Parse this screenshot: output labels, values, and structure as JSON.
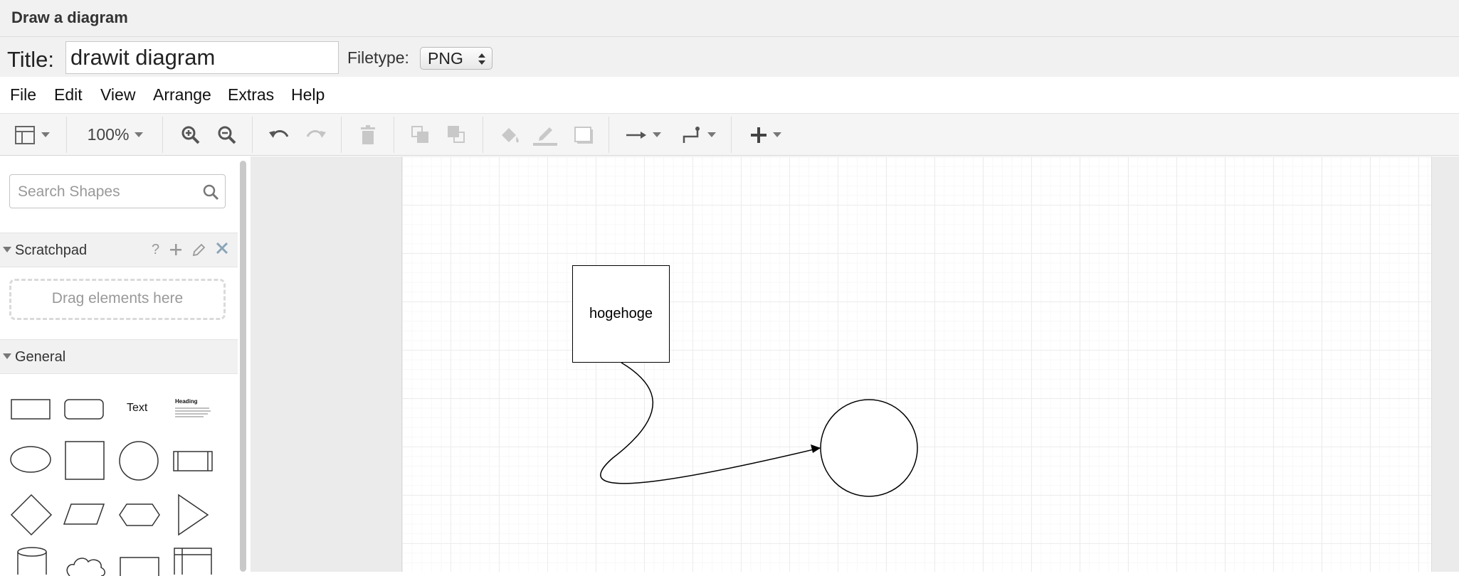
{
  "window": {
    "title": "Draw a diagram"
  },
  "form": {
    "title_label": "Title:",
    "title_value": "drawit diagram",
    "filetype_label": "Filetype:",
    "filetype_value": "PNG"
  },
  "menu": [
    "File",
    "Edit",
    "View",
    "Arrange",
    "Extras",
    "Help"
  ],
  "toolbar": {
    "zoom": "100%"
  },
  "sidebar": {
    "search_placeholder": "Search Shapes",
    "scratchpad": {
      "label": "Scratchpad",
      "help": "?",
      "dropzone": "Drag elements here"
    },
    "general": {
      "label": "General",
      "text_shape": "Text",
      "heading_shape": "Heading"
    }
  },
  "diagram": {
    "box_label": "hogehoge"
  }
}
